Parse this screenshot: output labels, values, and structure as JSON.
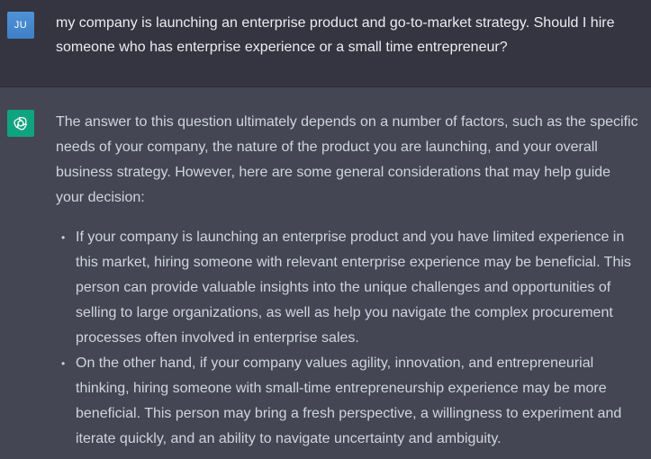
{
  "user": {
    "avatar_initials": "JU",
    "message": "my company is launching an enterprise product and go-to-market strategy. Should I hire someone who has enterprise experience or a small time entrepreneur?"
  },
  "assistant": {
    "avatar_icon": "openai-logo-icon",
    "intro": "The answer to this question ultimately depends on a number of factors, such as the specific needs of your company, the nature of the product you are launching, and your overall business strategy. However, here are some general considerations that may help guide your decision:",
    "points": [
      "If your company is launching an enterprise product and you have limited experience in this market, hiring someone with relevant enterprise experience may be beneficial. This person can provide valuable insights into the unique challenges and opportunities of selling to large organizations, as well as help you navigate the complex procurement processes often involved in enterprise sales.",
      "On the other hand, if your company values agility, innovation, and entrepreneurial thinking, hiring someone with small-time entrepreneurship experience may be more beneficial. This person may bring a fresh perspective, a willingness to experiment and iterate quickly, and an ability to navigate uncertainty and ambiguity."
    ]
  },
  "colors": {
    "user_bg": "#343541",
    "assistant_bg": "#444654",
    "user_avatar": "#4f92d6",
    "assistant_avatar": "#10a37f"
  }
}
